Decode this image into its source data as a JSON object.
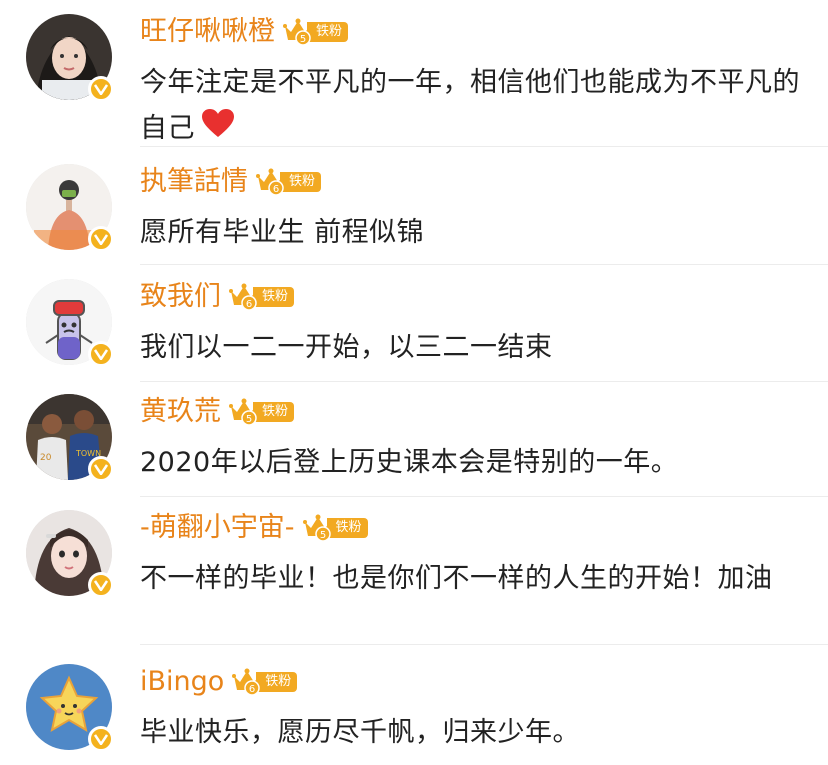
{
  "comments": [
    {
      "username": "旺仔啾啾橙",
      "fan_level": "5",
      "fan_label": "铁粉",
      "text": "今年注定是不平凡的一年，相信他们也能成为不平凡的自己",
      "emoji": "heart-icon",
      "avatar": "woman-portrait"
    },
    {
      "username": "执筆話情",
      "fan_level": "6",
      "fan_label": "铁粉",
      "text": "愿所有毕业生 前程似锦",
      "avatar": "masked-figure"
    },
    {
      "username": "致我们",
      "fan_level": "6",
      "fan_label": "铁粉",
      "text": "我们以一二一开始，以三二一结束",
      "avatar": "cartoon-bottle"
    },
    {
      "username": "黄玖荒",
      "fan_level": "5",
      "fan_label": "铁粉",
      "text": "2020年以后登上历史课本会是特别的一年。",
      "avatar": "basketball-players"
    },
    {
      "username": "-萌翻小宇宙-",
      "fan_level": "5",
      "fan_label": "铁粉",
      "text": "不一样的毕业！也是你们不一样的人生的开始！加油",
      "avatar": "girl-portrait"
    },
    {
      "username": "iBingo",
      "fan_level": "6",
      "fan_label": "铁粉",
      "text": "毕业快乐，愿历尽千帆，归来少年。",
      "avatar": "star-cartoon"
    }
  ],
  "colors": {
    "username": "#e8841a",
    "badge": "#f2a922",
    "verified": "#f4b21e",
    "text": "#222222",
    "divider": "#ececec"
  }
}
